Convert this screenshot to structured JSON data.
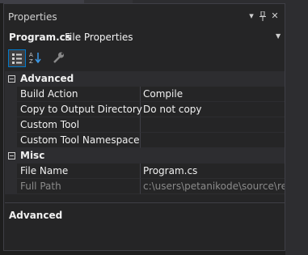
{
  "panel": {
    "title": "Properties",
    "menu_glyph": "▾",
    "pin_glyph": "⊥",
    "close_glyph": "✕"
  },
  "object": {
    "name": "Program.cs",
    "type": "File Properties",
    "dropdown_glyph": "▼"
  },
  "toolbar": {
    "categorized_icon": "categorized-icon",
    "alphabetical_icon": "alphabetical-icon",
    "property_pages_icon": "wrench-icon"
  },
  "categories": [
    {
      "label": "Advanced",
      "rows": [
        {
          "name": "Build Action",
          "value": "Compile"
        },
        {
          "name": "Copy to Output Directory",
          "value": "Do not copy"
        },
        {
          "name": "Custom Tool",
          "value": ""
        },
        {
          "name": "Custom Tool Namespace",
          "value": ""
        }
      ]
    },
    {
      "label": "Misc",
      "rows": [
        {
          "name": "File Name",
          "value": "Program.cs"
        },
        {
          "name": "Full Path",
          "value": "c:\\users\\petanikode\\source\\repo"
        }
      ]
    }
  ],
  "description": {
    "title": "Advanced"
  },
  "colors": {
    "accent": "#007acc",
    "background": "#252526",
    "category_bg": "#2d2d30"
  }
}
